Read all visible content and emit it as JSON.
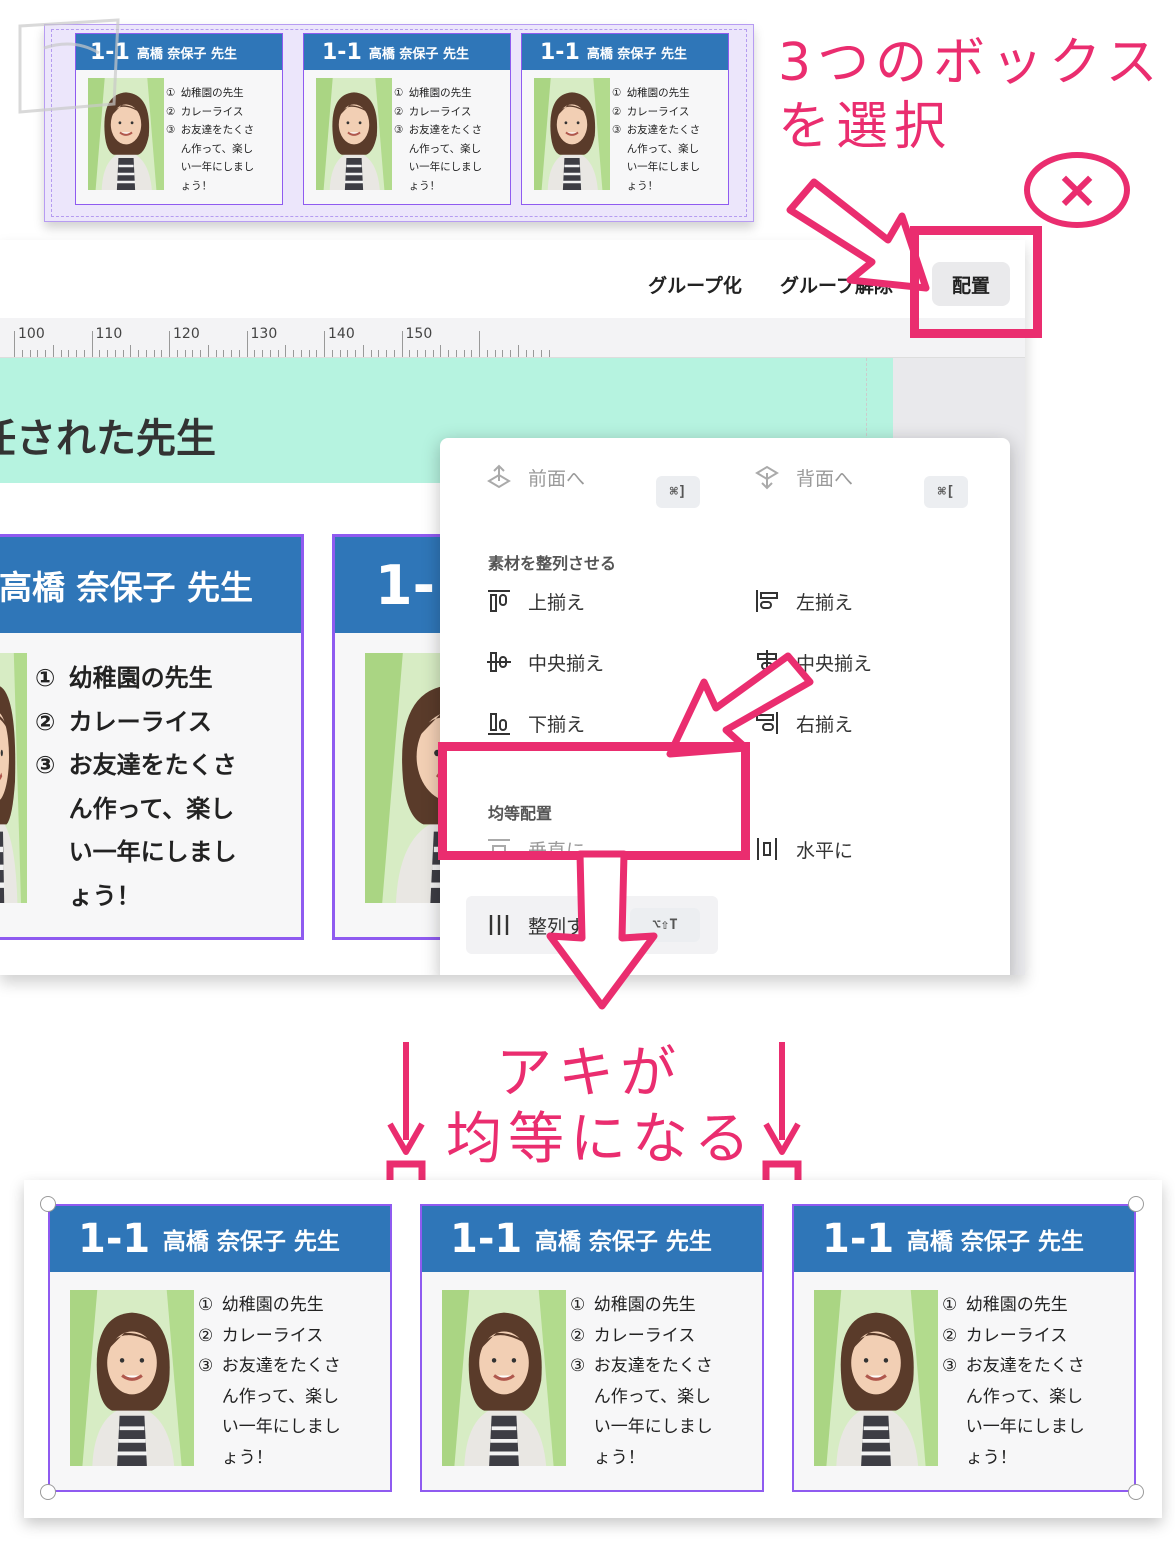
{
  "annotations": {
    "select_note_line1": "3つのボックス",
    "select_note_line2": "を選択",
    "x_mark": "×",
    "result_line1": "アキが",
    "result_line2": "均等になる"
  },
  "card": {
    "class_label": "1-1",
    "teacher_name": "高橋 奈保子 先生",
    "items": [
      {
        "num": "①",
        "text": "幼稚園の先生"
      },
      {
        "num": "②",
        "text": "カレーライス"
      },
      {
        "num": "③",
        "text": "お友達をたくさ"
      },
      {
        "num": "",
        "text": "ん作って、楽し"
      },
      {
        "num": "",
        "text": "い一年にしまし"
      },
      {
        "num": "",
        "text": "ょう！"
      }
    ]
  },
  "toolbar": {
    "group_label": "グループ化",
    "ungroup_label": "グループ解除",
    "arrange_label": "配置"
  },
  "ruler": {
    "labels": [
      "100",
      "110",
      "120",
      "130",
      "140",
      "150"
    ]
  },
  "canvas": {
    "banner_text": "任された先生",
    "zoom_class": "1-",
    "zoom_last_line": "う！"
  },
  "menu": {
    "forward_label": "前面へ",
    "forward_shortcut": "⌘]",
    "backward_label": "背面へ",
    "backward_shortcut": "⌘[",
    "align_section": "素材を整列させる",
    "align_top": "上揃え",
    "align_left": "左揃え",
    "align_middle": "中央揃え",
    "align_center": "中央揃え",
    "align_bottom": "下揃え",
    "align_right": "右揃え",
    "distribute_section": "均等配置",
    "vertical_label": "垂直に",
    "horizontal_label": "水平に",
    "tidy_label": "整列する",
    "tidy_shortcut": "⌥⇧T"
  },
  "colors": {
    "accent_pink": "#ea2d6f",
    "header_blue": "#2f76b8",
    "selection_purple": "#8f5bf0",
    "banner_mint": "#b6f3e0"
  }
}
